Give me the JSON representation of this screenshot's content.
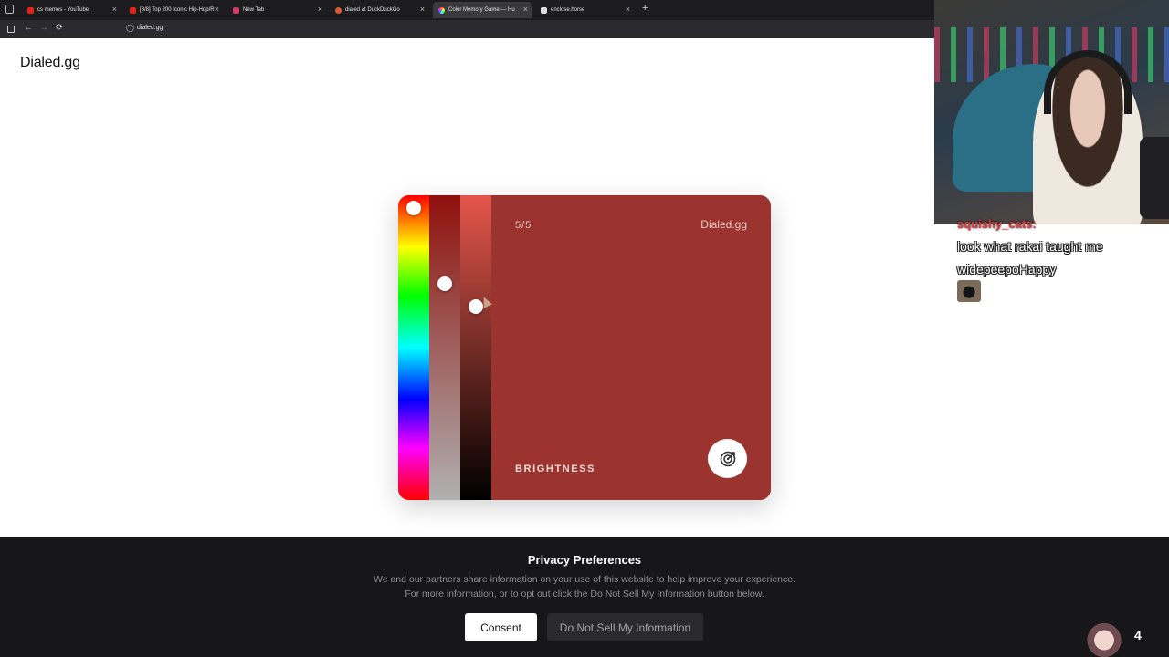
{
  "browser": {
    "tabs": [
      {
        "title": "cs memes - YouTube",
        "favicon_color": "#e62117"
      },
      {
        "title": "[8/8] Top 200 Iconic Hip-Hop/R",
        "favicon_color": "#e62117"
      },
      {
        "title": "New Tab",
        "favicon_color": "#d23a62"
      },
      {
        "title": "dialed at DuckDuckGo",
        "favicon_color": "#de5833"
      },
      {
        "title": "Color Memory Game — Hu",
        "favicon_color": "#7b61ff"
      },
      {
        "title": "enclose.horse",
        "favicon_color": "#dddddd"
      }
    ],
    "active_tab_index": 4,
    "new_tab_label": "+",
    "tab_close_glyph": "×",
    "url": "dialed.gg",
    "nav": {
      "back": "←",
      "forward": "→",
      "reload": "⟳"
    }
  },
  "page": {
    "brand": "Dialed.gg"
  },
  "game": {
    "round": "5/5",
    "brand": "Dialed.gg",
    "mode": "BRIGHTNESS",
    "color": "#9b342f",
    "hue_level": 0.02,
    "saturation_level": 0.28,
    "brightness_level": 0.36,
    "submit_icon": "target-icon"
  },
  "stream": {
    "chat_username": "squishy_cats:",
    "chat_message": "look what rakai taught me widepeepoHappy",
    "viewer_count": "4"
  },
  "consent": {
    "title": "Privacy Preferences",
    "line1": "We and our partners share information on your use of this website to help improve your experience.",
    "line2": "For more information, or to opt out click the Do Not Sell My Information button below.",
    "consent_label": "Consent",
    "dns_label": "Do Not Sell My Information"
  }
}
